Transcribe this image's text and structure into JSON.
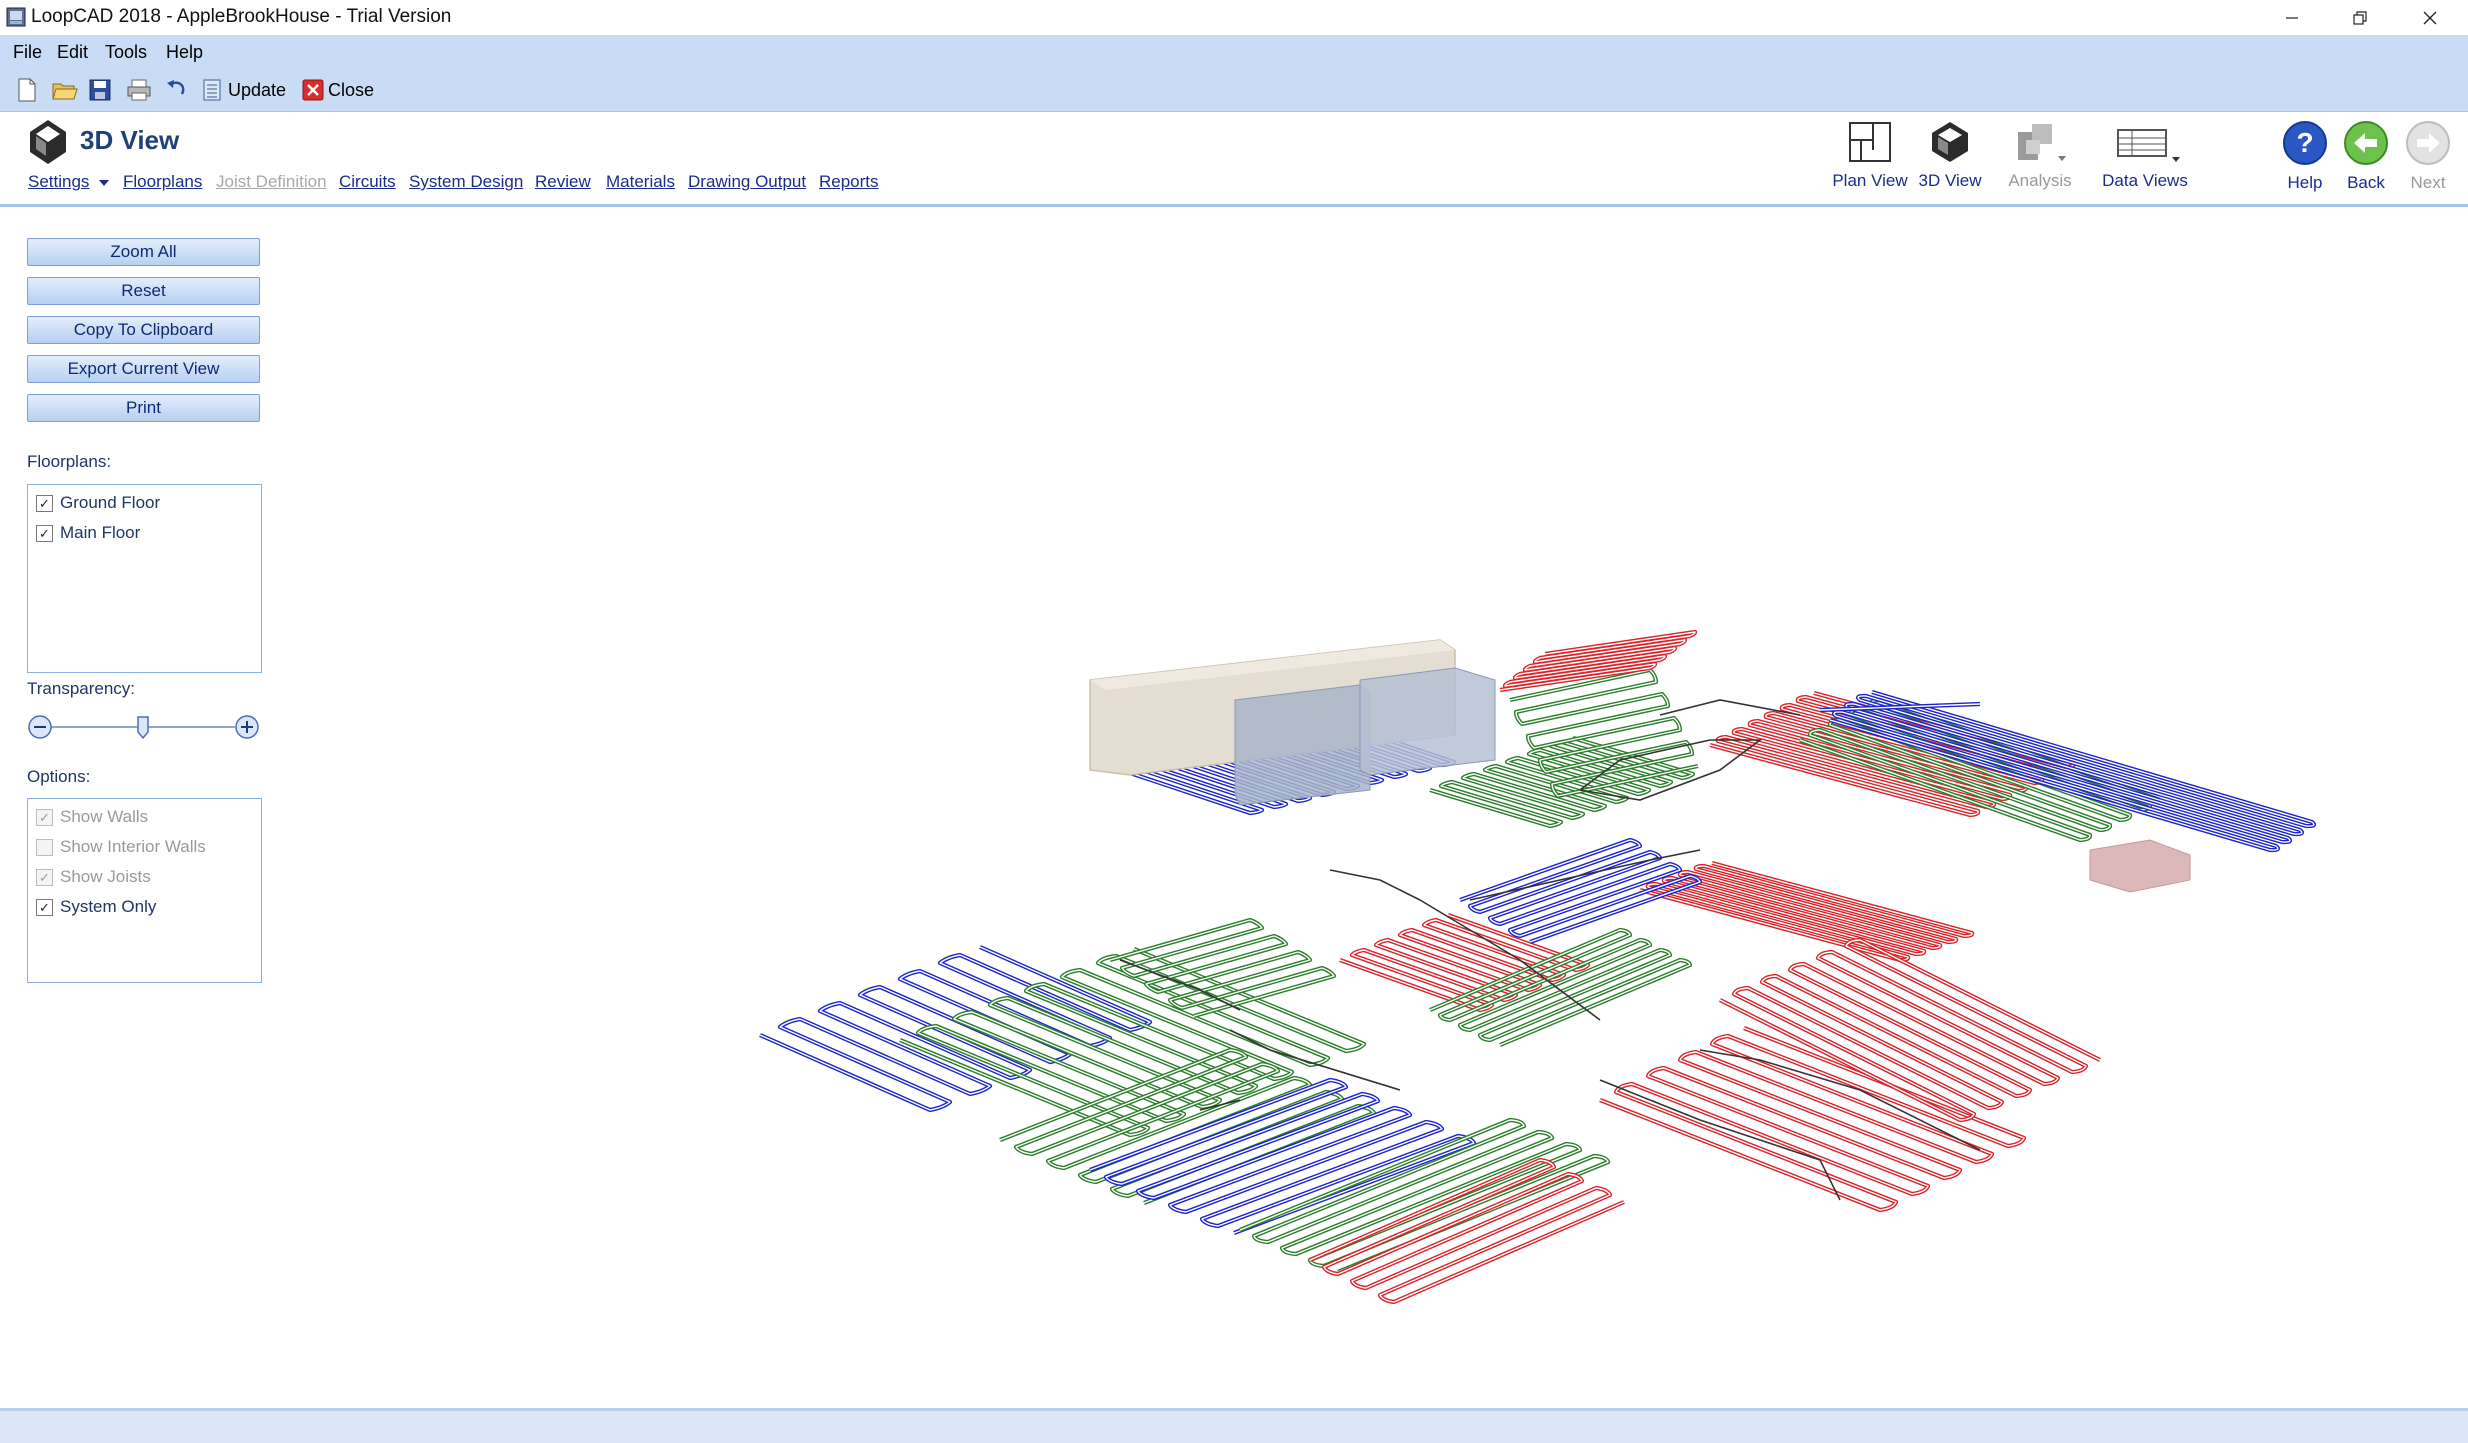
{
  "window": {
    "title": "LoopCAD 2018 - AppleBrookHouse - Trial Version"
  },
  "menu": [
    "File",
    "Edit",
    "Tools",
    "Help"
  ],
  "toolbar": {
    "update_label": "Update",
    "close_label": "Close",
    "icons": [
      "new-document-icon",
      "open-folder-icon",
      "save-icon",
      "print-icon",
      "undo-icon",
      "update-icon",
      "close-icon"
    ]
  },
  "ribbon": {
    "view_title": "3D View",
    "nav": [
      {
        "label": "Settings",
        "enabled": true
      },
      {
        "label": "Floorplans",
        "enabled": true
      },
      {
        "label": "Joist Definition",
        "enabled": false
      },
      {
        "label": "Circuits",
        "enabled": true
      },
      {
        "label": "System Design",
        "enabled": true
      },
      {
        "label": "Review",
        "enabled": true
      },
      {
        "label": "Materials",
        "enabled": true
      },
      {
        "label": "Drawing Output",
        "enabled": true
      },
      {
        "label": "Reports",
        "enabled": true
      }
    ],
    "buttons": [
      {
        "label": "Plan View",
        "enabled": true
      },
      {
        "label": "3D View",
        "enabled": true
      },
      {
        "label": "Analysis",
        "enabled": false
      },
      {
        "label": "Data Views",
        "enabled": true
      },
      {
        "label": "Help",
        "enabled": true
      },
      {
        "label": "Back",
        "enabled": true
      },
      {
        "label": "Next",
        "enabled": false
      }
    ]
  },
  "left_panel": {
    "buttons": [
      "Zoom All",
      "Reset",
      "Copy To Clipboard",
      "Export Current View",
      "Print"
    ],
    "floorplans_label": "Floorplans:",
    "floorplans": [
      {
        "label": "Ground Floor",
        "checked": true
      },
      {
        "label": "Main Floor",
        "checked": true
      }
    ],
    "transparency_label": "Transparency:",
    "transparency_level": 0.5,
    "options_label": "Options:",
    "options": [
      {
        "label": "Show Walls",
        "checked": true,
        "enabled": false
      },
      {
        "label": "Show Interior Walls",
        "checked": false,
        "enabled": false
      },
      {
        "label": "Show Joists",
        "checked": true,
        "enabled": false
      },
      {
        "label": "System Only",
        "checked": true,
        "enabled": true
      }
    ]
  },
  "colors": {
    "loop_red": "#d8242b",
    "loop_green": "#2c7d2c",
    "loop_blue": "#1c25c8",
    "accent": "#c9dcf5"
  }
}
